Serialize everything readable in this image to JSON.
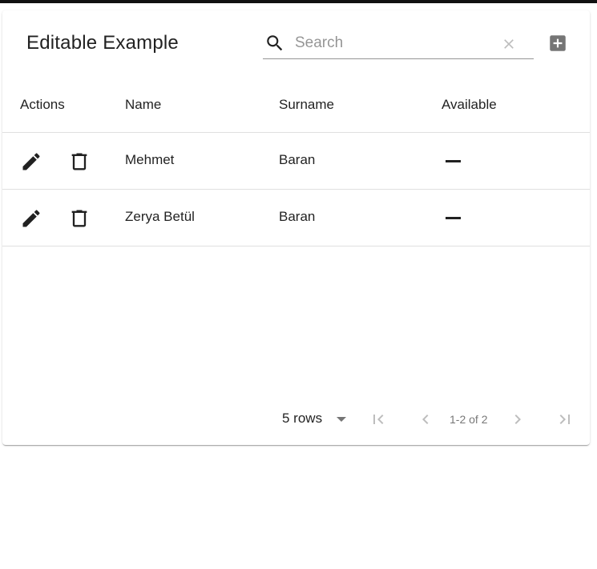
{
  "toolbar": {
    "title": "Editable Example",
    "search_placeholder": "Search",
    "search_value": ""
  },
  "columns": [
    "Actions",
    "Name",
    "Surname",
    "Available"
  ],
  "rows": [
    {
      "name": "Mehmet",
      "surname": "Baran",
      "available": "—"
    },
    {
      "name": "Zerya Betül",
      "surname": "Baran",
      "available": "—"
    }
  ],
  "pagination": {
    "rows_per_page": "5 rows",
    "page_info": "1-2 of 2"
  },
  "icons": {
    "search": "search-icon",
    "clear": "close-icon",
    "add": "add-box-icon",
    "edit": "pencil-icon",
    "delete": "trash-icon",
    "first": "first-page-icon",
    "prev": "chevron-left-icon",
    "next": "chevron-right-icon",
    "last": "last-page-icon"
  }
}
